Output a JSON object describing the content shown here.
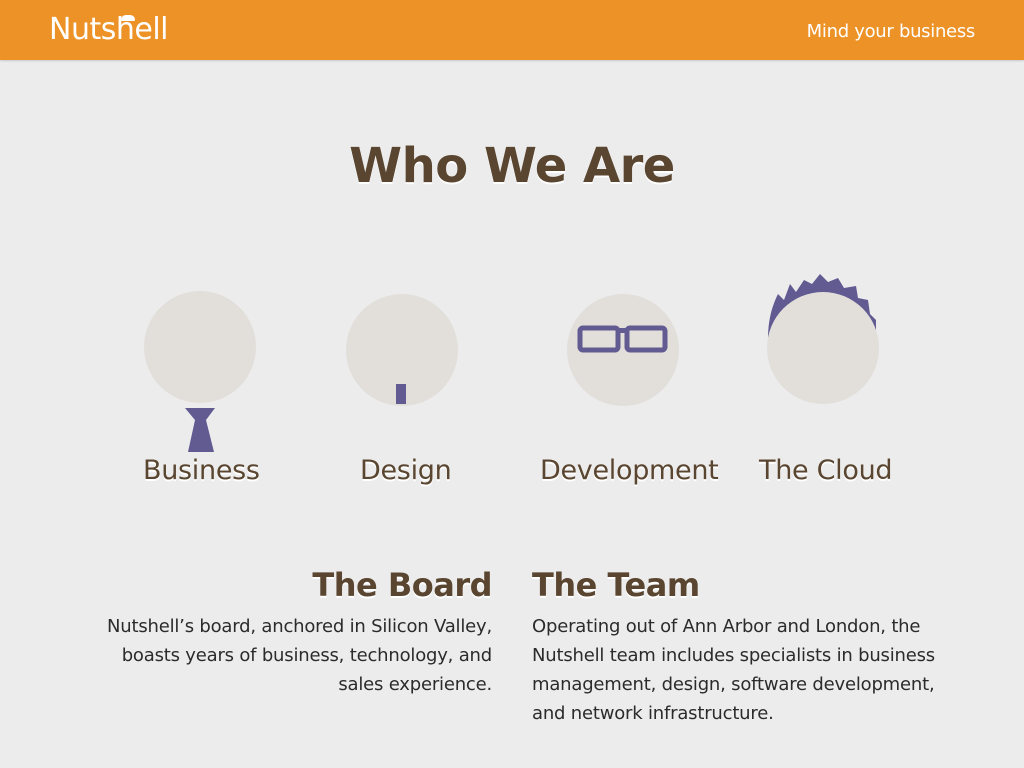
{
  "header": {
    "logo_text": "Nutshell",
    "tagline": "Mind your business",
    "background_color": "#ec9226"
  },
  "main": {
    "title": "Who We Are",
    "avatars": [
      {
        "label": "Business",
        "icon": "tie-icon"
      },
      {
        "label": "Design",
        "icon": "goatee-icon"
      },
      {
        "label": "Development",
        "icon": "glasses-icon"
      },
      {
        "label": "The Cloud",
        "icon": "spiky-hair-icon"
      }
    ],
    "accent_color": "#625b92",
    "sections": {
      "board": {
        "heading": "The Board",
        "body": "Nutshell’s board, anchored in Silicon Valley, boasts years of business, technology, and sales experience."
      },
      "team": {
        "heading": "The Team",
        "body": "Operating out of Ann Arbor and London, the Nutshell team  includes specialists in business management, design, software development, and network infrastructure."
      }
    }
  }
}
